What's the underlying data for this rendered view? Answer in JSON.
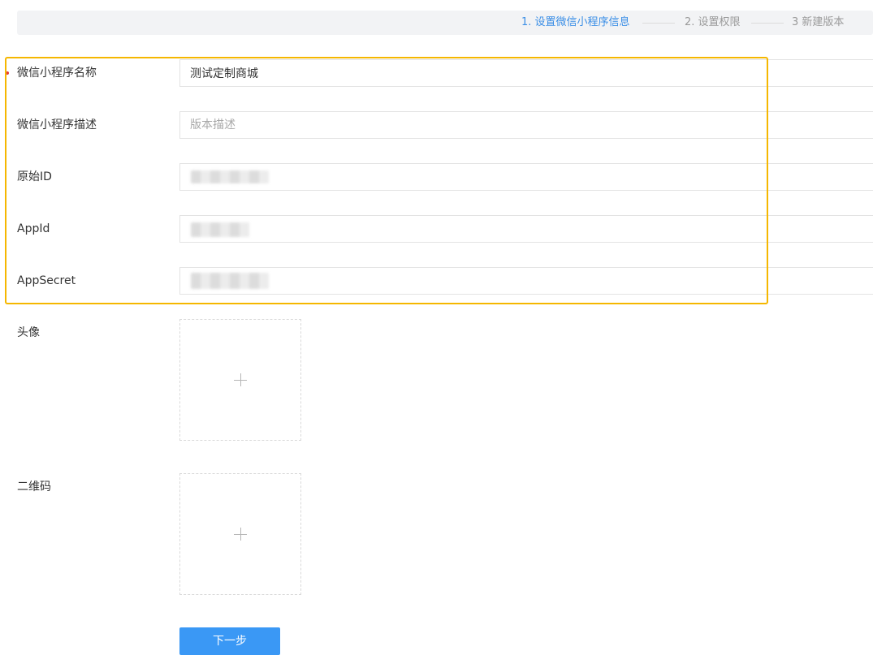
{
  "steps": [
    {
      "label": "1. 设置微信小程序信息",
      "state": "active"
    },
    {
      "label": "2. 设置权限",
      "state": "inactive"
    },
    {
      "label": "3 新建版本",
      "state": "inactive"
    }
  ],
  "form": {
    "name": {
      "label": "微信小程序名称",
      "value": "测试定制商城",
      "required": true
    },
    "description": {
      "label": "微信小程序描述",
      "value": "",
      "placeholder": "版本描述"
    },
    "original_id": {
      "label": "原始ID",
      "value": ""
    },
    "app_id": {
      "label": "AppId",
      "value": ""
    },
    "app_secret": {
      "label": "AppSecret",
      "value": ""
    },
    "avatar": {
      "label": "头像"
    },
    "qrcode": {
      "label": "二维码"
    }
  },
  "actions": {
    "next_label": "下一步"
  },
  "colors": {
    "accent": "#3a8ee6",
    "highlight_border": "#f5b700",
    "required_dot": "#e23b3b",
    "button_bg": "#3a98f5"
  },
  "icons": {
    "upload": "plus-icon"
  }
}
